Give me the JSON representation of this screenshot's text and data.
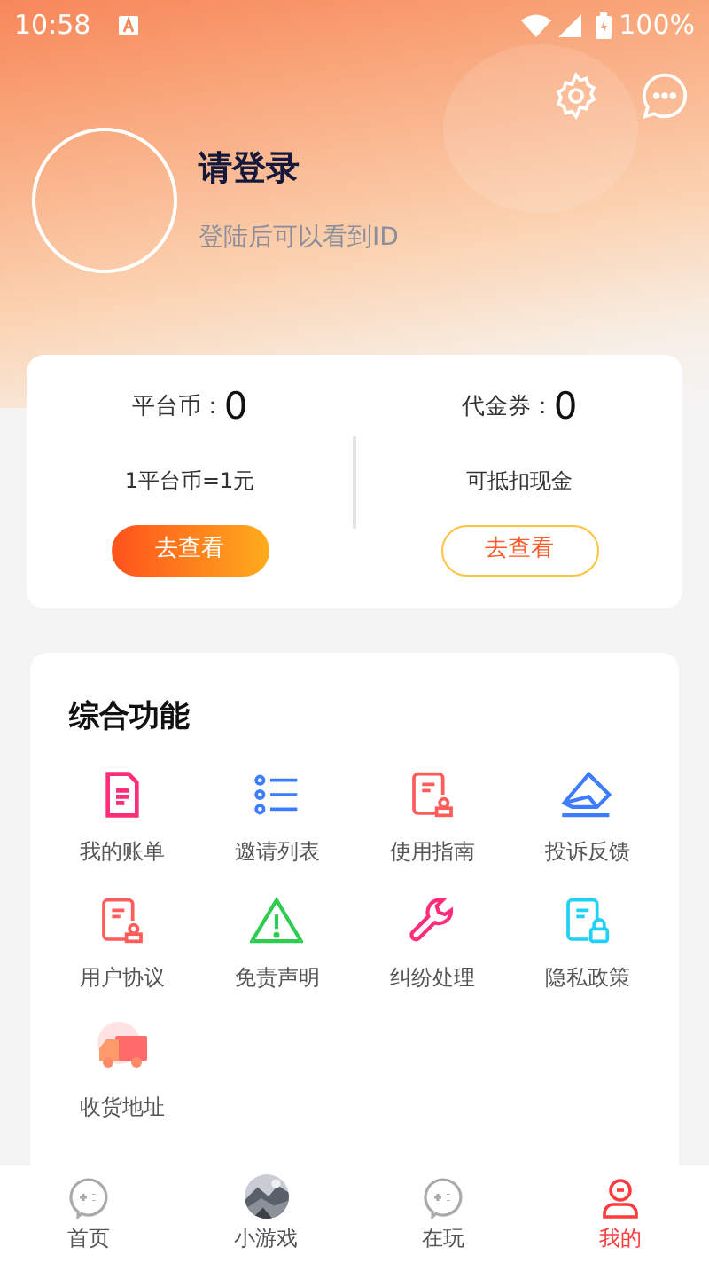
{
  "status_bar": {
    "time": "10:58",
    "battery": "100%"
  },
  "profile": {
    "title": "请登录",
    "subtitle": "登陆后可以看到ID"
  },
  "wallet": [
    {
      "label": "平台币：",
      "value": "0",
      "note": "1平台币=1元",
      "button": "去查看",
      "kind": "filled"
    },
    {
      "label": "代金券：",
      "value": "0",
      "note": "可抵扣现金",
      "button": "去查看",
      "kind": "outline"
    }
  ],
  "features": {
    "title": "综合功能",
    "items": [
      {
        "label": "我的账单",
        "kind": "bill"
      },
      {
        "label": "邀请列表",
        "kind": "list"
      },
      {
        "label": "使用指南",
        "kind": "guide"
      },
      {
        "label": "投诉反馈",
        "kind": "feedback"
      },
      {
        "label": "用户协议",
        "kind": "guide"
      },
      {
        "label": "免责声明",
        "kind": "warning"
      },
      {
        "label": "纠纷处理",
        "kind": "wrench"
      },
      {
        "label": "隐私政策",
        "kind": "privacy"
      },
      {
        "label": "收货地址",
        "kind": "truck"
      }
    ]
  },
  "tabs": [
    {
      "label": "首页",
      "kind": "chat",
      "selected": false
    },
    {
      "label": "小游戏",
      "kind": "picture",
      "selected": false
    },
    {
      "label": "在玩",
      "kind": "chat",
      "selected": false
    },
    {
      "label": "我的",
      "kind": "user",
      "selected": true
    }
  ]
}
